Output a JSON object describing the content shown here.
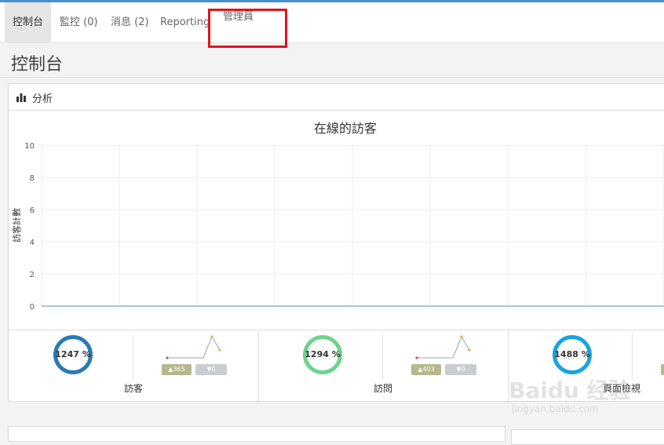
{
  "nav": {
    "tabs": [
      {
        "label": "控制台",
        "active": true
      },
      {
        "label": "監控 (0)",
        "active": false
      },
      {
        "label": "消息 (2)",
        "active": false
      },
      {
        "label": "Reporting",
        "active": false
      },
      {
        "label": "管理員",
        "active": false
      }
    ]
  },
  "page": {
    "title": "控制台"
  },
  "panel": {
    "title": "分析",
    "icon": "bar-chart-icon"
  },
  "chart_data": {
    "type": "line",
    "title": "在線的訪客",
    "ylabel": "訪客計數",
    "xlabel": "",
    "ylim": [
      0,
      10
    ],
    "yticks": [
      0,
      2,
      4,
      6,
      8,
      10
    ],
    "grid": true,
    "series": [
      {
        "values": [
          0,
          0,
          0,
          0,
          0,
          0,
          0,
          0,
          0
        ],
        "color": "#8fb3c9"
      }
    ]
  },
  "stats": [
    {
      "percent": "1247 %",
      "up": "365",
      "down": "0",
      "label": "訪客",
      "color": "#2a7ab5"
    },
    {
      "percent": "1294 %",
      "up": "403",
      "down": "0",
      "label": "訪問",
      "color": "#6fd38c"
    },
    {
      "percent": "1488 %",
      "up": "",
      "down": "",
      "label": "頁面檢視",
      "color": "#1aa4e0"
    }
  ],
  "watermark": {
    "main": "Baidu 经验",
    "sub": "jingyan.baidu.com"
  },
  "colors": {
    "accent": "#4a8fd0",
    "highlight": "#e0141e"
  }
}
